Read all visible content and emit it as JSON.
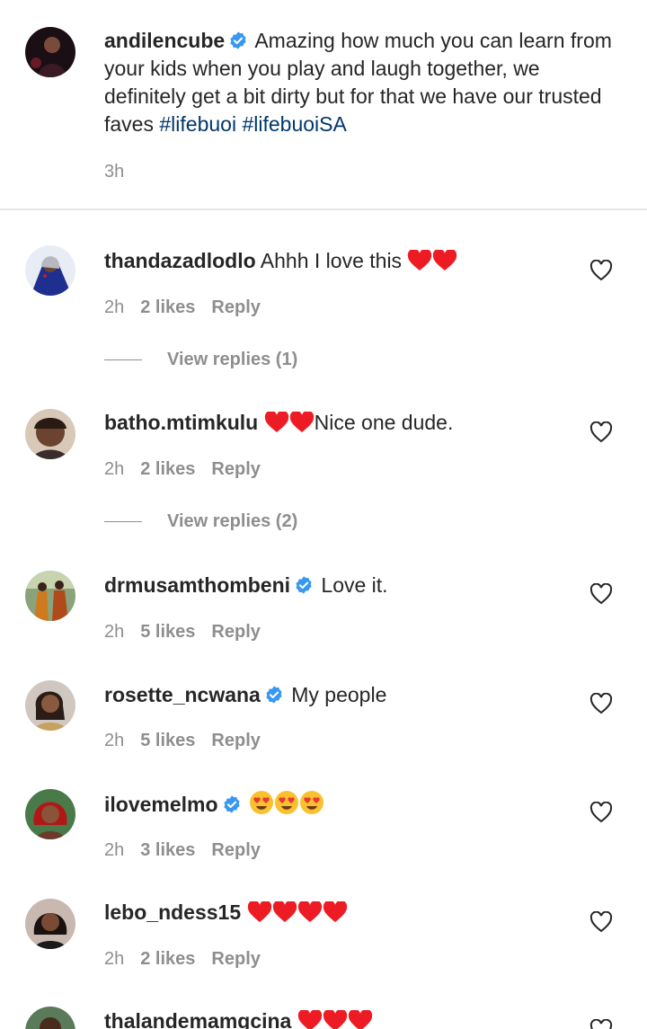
{
  "caption": {
    "username": "andilencube",
    "verified": true,
    "text": "Amazing how much you can learn from your kids when you play and laugh together, we definitely get a bit dirty but for that we have our trusted faves",
    "hashtags": [
      "#lifebuoi",
      "#lifebuoiSA"
    ],
    "time": "3h"
  },
  "comments": [
    {
      "username": "thandazadlodlo",
      "verified": false,
      "text": "Ahhh I love this",
      "emoji": [
        "red-heart",
        "red-heart"
      ],
      "emoji_position": "after",
      "time": "2h",
      "likes": "2 likes",
      "reply": "Reply",
      "view_replies": "View replies (1)"
    },
    {
      "username": "batho.mtimkulu",
      "verified": false,
      "text": "Nice one dude.",
      "emoji": [
        "red-heart",
        "red-heart"
      ],
      "emoji_position": "before",
      "time": "2h",
      "likes": "2 likes",
      "reply": "Reply",
      "view_replies": "View replies (2)"
    },
    {
      "username": "drmusamthombeni",
      "verified": true,
      "text": "Love it.",
      "emoji": [],
      "time": "2h",
      "likes": "5 likes",
      "reply": "Reply"
    },
    {
      "username": "rosette_ncwana",
      "verified": true,
      "text": "My people",
      "emoji": [],
      "time": "2h",
      "likes": "5 likes",
      "reply": "Reply"
    },
    {
      "username": "ilovemelmo",
      "verified": true,
      "text": "",
      "emoji": [
        "heart-eyes",
        "heart-eyes",
        "heart-eyes"
      ],
      "emoji_position": "after",
      "time": "2h",
      "likes": "3 likes",
      "reply": "Reply"
    },
    {
      "username": "lebo_ndess15",
      "verified": false,
      "text": "",
      "emoji": [
        "red-heart",
        "red-heart",
        "red-heart",
        "red-heart"
      ],
      "emoji_position": "after",
      "time": "2h",
      "likes": "2 likes",
      "reply": "Reply"
    },
    {
      "username": "thalandemamgcina",
      "verified": false,
      "text": "",
      "emoji": [
        "red-heart",
        "red-heart",
        "red-heart"
      ],
      "emoji_position": "after"
    }
  ],
  "colors": {
    "text": "#262626",
    "secondary": "#8e8e8e",
    "hashtag": "#00376b",
    "verified": "#3897f0",
    "heart": "#ed1b24",
    "divider": "#e6e6e6"
  }
}
